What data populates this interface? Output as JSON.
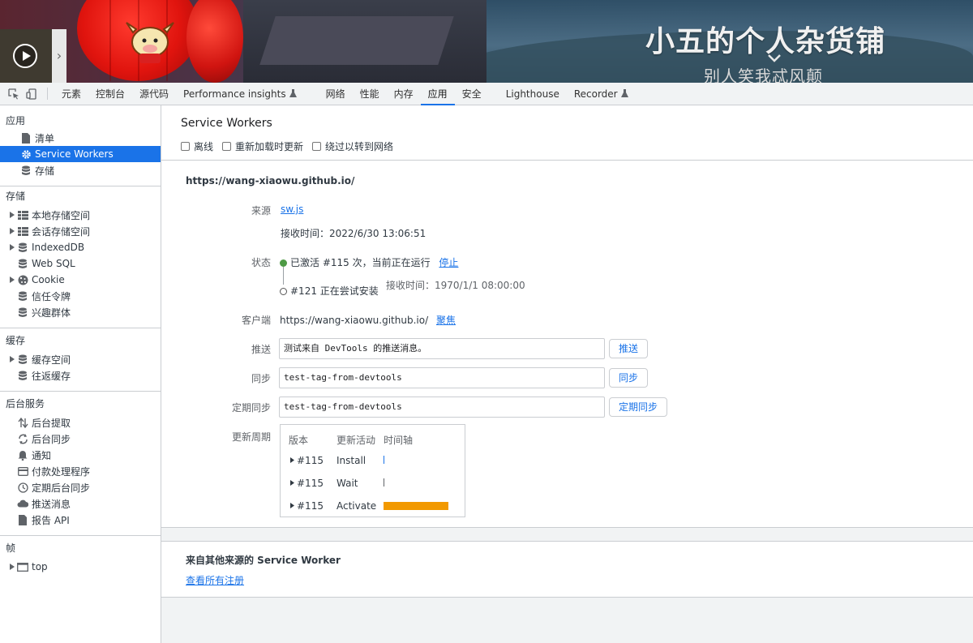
{
  "banner": {
    "site_title": "小五的个人杂货铺",
    "site_subtitle": "别人笑我忒风颠",
    "player_icon": "play-icon",
    "next_icon": "chevron-right-icon"
  },
  "toolbar": {
    "tabs": [
      {
        "label": "元素"
      },
      {
        "label": "控制台"
      },
      {
        "label": "源代码"
      },
      {
        "label": "Performance insights"
      },
      {
        "label": "网络"
      },
      {
        "label": "性能"
      },
      {
        "label": "内存"
      },
      {
        "label": "应用"
      },
      {
        "label": "安全"
      },
      {
        "label": "Lighthouse"
      },
      {
        "label": "Recorder"
      }
    ],
    "active_tab": "应用",
    "accent": "#1a73e8"
  },
  "sidebar": {
    "app_title": "应用",
    "app_items": [
      {
        "label": "清单",
        "icon": "file-icon"
      },
      {
        "label": "Service Workers",
        "icon": "gear-icon"
      },
      {
        "label": "存储",
        "icon": "database-icon"
      }
    ],
    "storage_title": "存储",
    "storage_items": [
      {
        "label": "本地存储空间",
        "icon": "grid-icon"
      },
      {
        "label": "会话存储空间",
        "icon": "grid-icon"
      },
      {
        "label": "IndexedDB",
        "icon": "database-icon"
      },
      {
        "label": "Web SQL",
        "icon": "database-icon"
      },
      {
        "label": "Cookie",
        "icon": "cookie-icon"
      },
      {
        "label": "信任令牌",
        "icon": "database-icon"
      },
      {
        "label": "兴趣群体",
        "icon": "database-icon"
      }
    ],
    "cache_title": "缓存",
    "cache_items": [
      {
        "label": "缓存空间",
        "icon": "database-icon"
      },
      {
        "label": "往返缓存",
        "icon": "database-icon"
      }
    ],
    "bg_title": "后台服务",
    "bg_items": [
      {
        "label": "后台提取",
        "icon": "arrows-up-down-icon"
      },
      {
        "label": "后台同步",
        "icon": "sync-icon"
      },
      {
        "label": "通知",
        "icon": "bell-icon"
      },
      {
        "label": "付款处理程序",
        "icon": "card-icon"
      },
      {
        "label": "定期后台同步",
        "icon": "clock-icon"
      },
      {
        "label": "推送消息",
        "icon": "cloud-icon"
      },
      {
        "label": "报告 API",
        "icon": "file-icon"
      }
    ],
    "frames_title": "帧",
    "frames_items": [
      {
        "label": "top",
        "icon": "window-icon"
      }
    ]
  },
  "main": {
    "title": "Service Workers",
    "options": [
      {
        "label": "离线",
        "checked": false
      },
      {
        "label": "重新加载时更新",
        "checked": false
      },
      {
        "label": "绕过以转到网络",
        "checked": false
      }
    ],
    "origin": "https://wang-xiaowu.github.io/",
    "source_label": "来源",
    "source_link": "sw.js",
    "received_text": "接收时间：2022/6/30 13:06:51",
    "status_label": "状态",
    "status_active": "已激活 #115 次，当前正在运行",
    "stop_link": "停止",
    "status_installing": "#121 正在尝试安装",
    "installing_received": "接收时间：1970/1/1 08:00:00",
    "client_label": "客户端",
    "client_value": "https://wang-xiaowu.github.io/",
    "focus_link": "聚焦",
    "push_label": "推送",
    "push_value": "测试来自 DevTools 的推送消息。",
    "push_button": "推送",
    "sync_label": "同步",
    "sync_value": "test-tag-from-devtools",
    "sync_button": "同步",
    "periodic_label": "定期同步",
    "periodic_value": "test-tag-from-devtools",
    "periodic_button": "定期同步",
    "cycle_label": "更新周期",
    "cycle_headers": [
      "版本",
      "更新活动",
      "时间轴"
    ],
    "cycle_rows": [
      {
        "version": "#115",
        "activity": "Install",
        "bar": "tick"
      },
      {
        "version": "#115",
        "activity": "Wait",
        "bar": "tick"
      },
      {
        "version": "#115",
        "activity": "Activate",
        "bar": "full"
      }
    ],
    "cycle_bar_color": "#f29900",
    "other_title": "来自其他来源的 Service Worker",
    "other_link": "查看所有注册"
  }
}
